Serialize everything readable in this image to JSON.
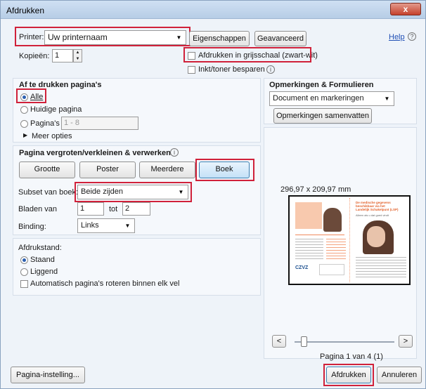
{
  "window": {
    "title": "Afdrukken",
    "close": "x"
  },
  "printer": {
    "label": "Printer:",
    "value": "Uw printernaam",
    "properties": "Eigenschappen",
    "advanced": "Geavanceerd",
    "help": "Help"
  },
  "copies": {
    "label": "Kopieën:",
    "value": "1"
  },
  "options": {
    "grayscale": "Afdrukken in grijsschaal (zwart-wit)",
    "save_ink": "Inkt/toner besparen"
  },
  "pages": {
    "title": "Af te drukken pagina's",
    "all": "Alle",
    "current": "Huidige pagina",
    "pages": "Pagina's",
    "range_placeholder": "1 - 8",
    "more": "Meer opties"
  },
  "scaling": {
    "title": "Pagina vergroten/verkleinen & verwerken",
    "tabs": [
      "Grootte",
      "Poster",
      "Meerdere",
      "Boek"
    ],
    "subset_label": "Subset van boek:",
    "subset_value": "Beide zijden",
    "sheets_label": "Bladen van",
    "sheets_from": "1",
    "sheets_to_label": "tot",
    "sheets_to": "2",
    "binding_label": "Binding:",
    "binding_value": "Links"
  },
  "orientation": {
    "title": "Afdrukstand:",
    "portrait": "Staand",
    "landscape": "Liggend",
    "auto_rotate": "Automatisch pagina's roteren binnen elk vel"
  },
  "comments": {
    "title": "Opmerkingen & Formulieren",
    "value": "Document en markeringen",
    "summarize": "Opmerkingen samenvatten"
  },
  "preview": {
    "size": "296,97 x 209,97 mm",
    "page_info": "Pagina 1 van 4 (1)",
    "prev": "<",
    "next": ">"
  },
  "footer": {
    "page_setup": "Pagina-instelling...",
    "print": "Afdrukken",
    "cancel": "Annuleren"
  },
  "thumbnail": {
    "heading": "De medische gegevens beschikbaar via het Landelijk Schakelpunt (LSP)",
    "sub": "Alleen als u dat goed vindt",
    "logo": "CZVZ"
  },
  "accent": "#d0213a"
}
